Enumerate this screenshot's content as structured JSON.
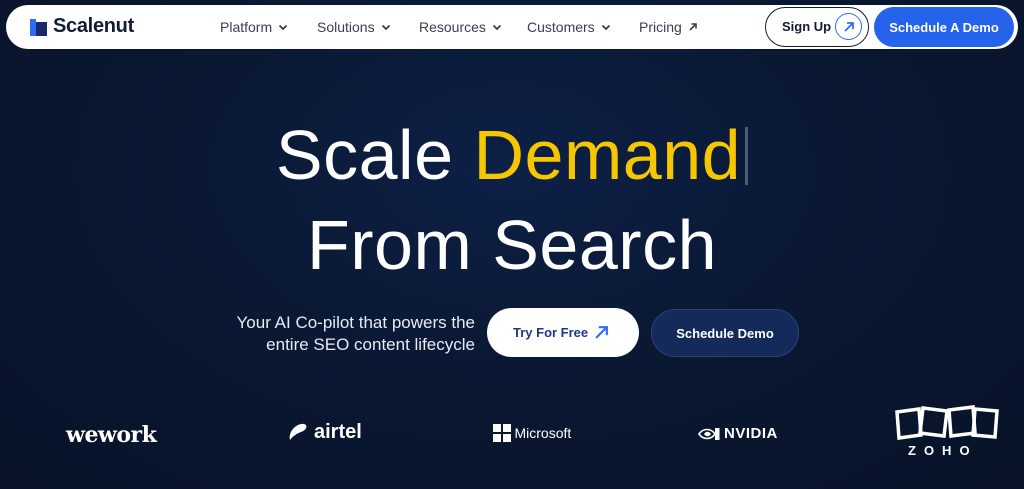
{
  "nav": {
    "brand": "Scalenut",
    "items": [
      {
        "label": "Platform"
      },
      {
        "label": "Solutions"
      },
      {
        "label": "Resources"
      },
      {
        "label": "Customers"
      },
      {
        "label": "Pricing"
      }
    ],
    "signup_label": "Sign Up",
    "demo_label": "Schedule A Demo"
  },
  "hero": {
    "line1_white": "Scale",
    "line1_accent": "Demand",
    "line2": "From Search",
    "sub_line1": "Your AI Co-pilot that powers the",
    "sub_line2": "entire SEO content lifecycle",
    "try_label": "Try For Free",
    "schedule_label": "Schedule Demo"
  },
  "logos": {
    "wework": "wework",
    "airtel": "airtel",
    "microsoft": "Microsoft",
    "nvidia": "NVIDIA",
    "zoho": "ZOHO"
  },
  "colors": {
    "accent": "#f6c700",
    "primary": "#2563eb",
    "background": "#0a1833"
  }
}
